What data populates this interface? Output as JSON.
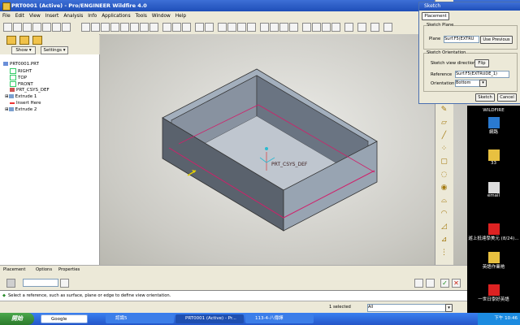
{
  "window": {
    "title": "PRT0001 (Active) - Pro/ENGINEER Wildfire 4.0"
  },
  "menu": [
    "File",
    "Edit",
    "View",
    "Insert",
    "Analysis",
    "Info",
    "Applications",
    "Tools",
    "Window",
    "Help"
  ],
  "tree": {
    "tabs": {
      "show": "Show ▾",
      "settings": "Settings ▾"
    },
    "items": [
      "PRT0001.PRT",
      "RIGHT",
      "TOP",
      "FRONT",
      "PRT_CSYS_DEF",
      "Extrude 1",
      "Insert Here",
      "Extrude 2"
    ]
  },
  "viewport": {
    "csys_label": "PRT_CSYS_DEF"
  },
  "sketch_dialog": {
    "title": "Sketch",
    "tab": "Placement",
    "plane_group": "Sketch Plane",
    "plane_label": "Plane",
    "plane_value": "Surf:F5(EXTRU",
    "use_previous": "Use Previous",
    "orientation_group": "Sketch Orientation",
    "view_direction_label": "Sketch view direction",
    "flip": "Flip",
    "reference_label": "Reference",
    "reference_value": "Surf:F5(EXTRUDE_1)",
    "orientation_label": "Orientation",
    "orientation_value": "Bottom",
    "sketch_button": "Sketch",
    "cancel_button": "Cancel"
  },
  "dashboard": {
    "tabs": [
      "Placement",
      "Options",
      "Properties"
    ]
  },
  "message": "Select a reference, such as surface, plane or edge to define view orientation.",
  "status": {
    "selected": "1 selected",
    "filter": "All"
  },
  "desktop": {
    "label_top": "WILDFIRE",
    "icons": [
      "網路",
      "33",
      "email",
      "遊上抵達學美元 (8/24)...",
      "英語作業祂",
      "一世日學好英語"
    ]
  },
  "taskbar": {
    "start": "開始",
    "google": "Google",
    "tasks": [
      "認識5",
      "PRT0001 (Active) - Pr...",
      "113-4-八傳譯"
    ],
    "clock": "下午 10:46"
  }
}
